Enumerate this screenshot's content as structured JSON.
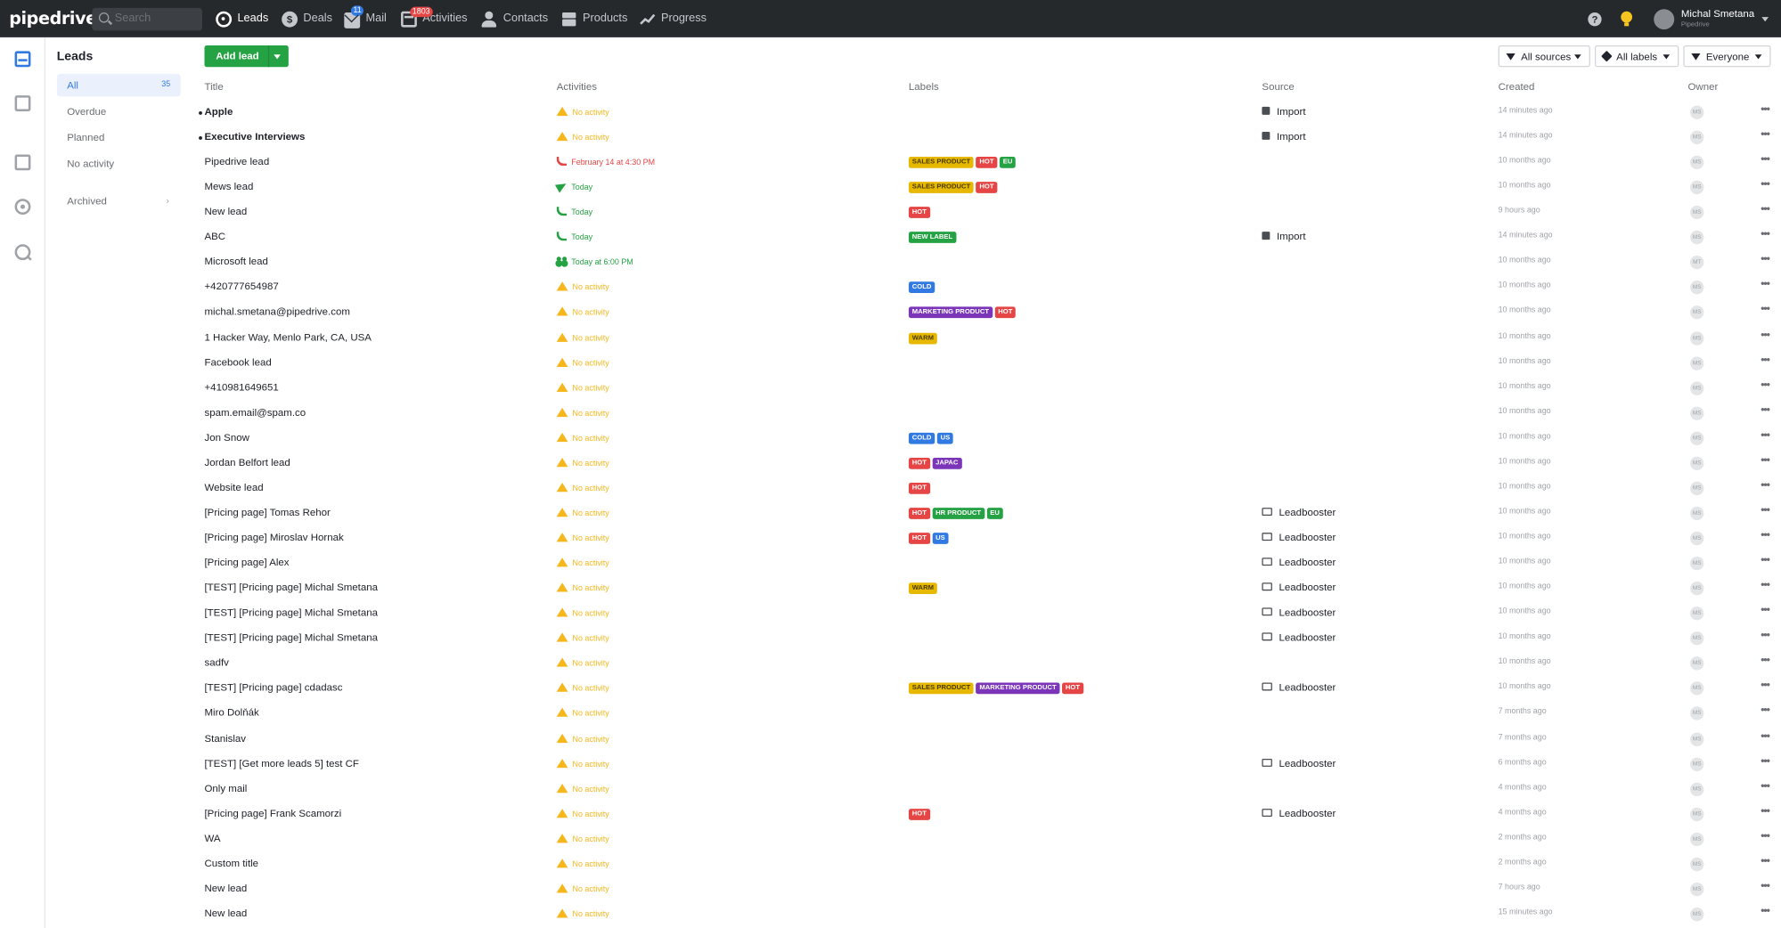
{
  "topbar": {
    "logo": "pipedrive",
    "search_placeholder": "Search",
    "nav": [
      {
        "label": "Leads",
        "icon": "target-icon",
        "active": true
      },
      {
        "label": "Deals",
        "icon": "dollar-icon"
      },
      {
        "label": "Mail",
        "icon": "mail-icon",
        "badge": "11"
      },
      {
        "label": "Activities",
        "icon": "calendar-icon",
        "badge": "1803"
      },
      {
        "label": "Contacts",
        "icon": "person-icon"
      },
      {
        "label": "Products",
        "icon": "box-icon"
      },
      {
        "label": "Progress",
        "icon": "trend-icon"
      }
    ],
    "help_icon": "?",
    "deals_icon": "$",
    "user_name": "Michal Smetana",
    "user_company": "Pipedrive"
  },
  "sidebar": {
    "title": "Leads",
    "items": [
      {
        "label": "All",
        "count": "35",
        "active": true
      },
      {
        "label": "Overdue"
      },
      {
        "label": "Planned"
      },
      {
        "label": "No activity"
      },
      {
        "label": "Archived",
        "chevron": "›"
      }
    ]
  },
  "toolbar": {
    "add_lead": "Add lead",
    "filters": [
      "All sources",
      "All labels",
      "Everyone"
    ]
  },
  "columns": [
    "Title",
    "Activities",
    "Labels",
    "Source",
    "Created",
    "Owner"
  ],
  "colors": {
    "accent": "#317ae2",
    "add_button": "#25a244",
    "warn": "#f5b71c",
    "overdue": "#e64545",
    "today": "#25a244"
  },
  "rows": [
    {
      "title": "Apple",
      "bold": true,
      "act": "No activity",
      "act_type": "none",
      "labels": [],
      "source": "Import",
      "src_type": "import",
      "created": "14 minutes ago",
      "owner": "MS"
    },
    {
      "title": "Executive Interviews",
      "bold": true,
      "act": "No activity",
      "act_type": "none",
      "labels": [],
      "source": "Import",
      "src_type": "import",
      "created": "14 minutes ago",
      "owner": "MS"
    },
    {
      "title": "Pipedrive lead",
      "act": "February 14 at 4:30 PM",
      "act_type": "overdue",
      "labels": [
        {
          "t": "SALES PRODUCT",
          "c": "#e6b800",
          "dark": true
        },
        {
          "t": "HOT",
          "c": "#e64545"
        },
        {
          "t": "EU",
          "c": "#25a244"
        }
      ],
      "source": "",
      "created": "10 months ago",
      "owner": "MS"
    },
    {
      "title": "Mews lead",
      "act": "Today",
      "act_type": "today-send",
      "labels": [
        {
          "t": "SALES PRODUCT",
          "c": "#e6b800",
          "dark": true
        },
        {
          "t": "HOT",
          "c": "#e64545"
        }
      ],
      "source": "",
      "created": "10 months ago",
      "owner": "MS"
    },
    {
      "title": "New lead",
      "act": "Today",
      "act_type": "today-call",
      "labels": [
        {
          "t": "HOT",
          "c": "#e64545"
        }
      ],
      "source": "",
      "created": "9 hours ago",
      "owner": "MS"
    },
    {
      "title": "ABC",
      "act": "Today",
      "act_type": "today-call",
      "labels": [
        {
          "t": "NEW LABEL",
          "c": "#25a244"
        }
      ],
      "source": "Import",
      "src_type": "import",
      "created": "14 minutes ago",
      "owner": "MS"
    },
    {
      "title": "Microsoft lead",
      "act": "Today at 6:00 PM",
      "act_type": "today-meet",
      "labels": [],
      "source": "",
      "created": "10 months ago",
      "owner": "MT"
    },
    {
      "title": "+420777654987",
      "act": "No activity",
      "act_type": "none",
      "labels": [
        {
          "t": "COLD",
          "c": "#317ae2"
        }
      ],
      "source": "",
      "created": "10 months ago",
      "owner": "MS"
    },
    {
      "title": "michal.smetana@pipedrive.com",
      "act": "No activity",
      "act_type": "none",
      "labels": [
        {
          "t": "MARKETING PRODUCT",
          "c": "#7a35b8"
        },
        {
          "t": "HOT",
          "c": "#e64545"
        }
      ],
      "source": "",
      "created": "10 months ago",
      "owner": "MS"
    },
    {
      "title": "1 Hacker Way, Menlo Park, CA, USA",
      "act": "No activity",
      "act_type": "none",
      "labels": [
        {
          "t": "WARM",
          "c": "#e6b800",
          "dark": true
        }
      ],
      "source": "",
      "created": "10 months ago",
      "owner": "MS"
    },
    {
      "title": "Facebook lead",
      "act": "No activity",
      "act_type": "none",
      "labels": [],
      "source": "",
      "created": "10 months ago",
      "owner": "MS"
    },
    {
      "title": "+410981649651",
      "act": "No activity",
      "act_type": "none",
      "labels": [],
      "source": "",
      "created": "10 months ago",
      "owner": "MS"
    },
    {
      "title": "spam.email@spam.co",
      "act": "No activity",
      "act_type": "none",
      "labels": [],
      "source": "",
      "created": "10 months ago",
      "owner": "MS"
    },
    {
      "title": "Jon Snow",
      "act": "No activity",
      "act_type": "none",
      "labels": [
        {
          "t": "COLD",
          "c": "#317ae2"
        },
        {
          "t": "US",
          "c": "#317ae2"
        }
      ],
      "source": "",
      "created": "10 months ago",
      "owner": "MS"
    },
    {
      "title": "Jordan Belfort lead",
      "act": "No activity",
      "act_type": "none",
      "labels": [
        {
          "t": "HOT",
          "c": "#e64545"
        },
        {
          "t": "JAPAC",
          "c": "#7a35b8"
        }
      ],
      "source": "",
      "created": "10 months ago",
      "owner": "MS"
    },
    {
      "title": "Website lead",
      "act": "No activity",
      "act_type": "none",
      "labels": [
        {
          "t": "HOT",
          "c": "#e64545"
        }
      ],
      "source": "",
      "created": "10 months ago",
      "owner": "MS"
    },
    {
      "title": "[Pricing page] Tomas Rehor",
      "act": "No activity",
      "act_type": "none",
      "labels": [
        {
          "t": "HOT",
          "c": "#e64545"
        },
        {
          "t": "HR PRODUCT",
          "c": "#25a244"
        },
        {
          "t": "EU",
          "c": "#25a244"
        }
      ],
      "source": "Leadbooster",
      "src_type": "lb",
      "created": "10 months ago",
      "owner": "MS"
    },
    {
      "title": "[Pricing page] Miroslav Hornak",
      "act": "No activity",
      "act_type": "none",
      "labels": [
        {
          "t": "HOT",
          "c": "#e64545"
        },
        {
          "t": "US",
          "c": "#317ae2"
        }
      ],
      "source": "Leadbooster",
      "src_type": "lb",
      "created": "10 months ago",
      "owner": "MS"
    },
    {
      "title": "[Pricing page] Alex",
      "act": "No activity",
      "act_type": "none",
      "labels": [],
      "source": "Leadbooster",
      "src_type": "lb",
      "created": "10 months ago",
      "owner": "MS"
    },
    {
      "title": "[TEST] [Pricing page] Michal Smetana",
      "act": "No activity",
      "act_type": "none",
      "labels": [
        {
          "t": "WARM",
          "c": "#e6b800",
          "dark": true
        }
      ],
      "source": "Leadbooster",
      "src_type": "lb",
      "created": "10 months ago",
      "owner": "MS"
    },
    {
      "title": "[TEST] [Pricing page] Michal Smetana",
      "act": "No activity",
      "act_type": "none",
      "labels": [],
      "source": "Leadbooster",
      "src_type": "lb",
      "created": "10 months ago",
      "owner": "MS"
    },
    {
      "title": "[TEST] [Pricing page] Michal Smetana",
      "act": "No activity",
      "act_type": "none",
      "labels": [],
      "source": "Leadbooster",
      "src_type": "lb",
      "created": "10 months ago",
      "owner": "MS"
    },
    {
      "title": "sadfv",
      "act": "No activity",
      "act_type": "none",
      "labels": [],
      "source": "",
      "created": "10 months ago",
      "owner": "MS"
    },
    {
      "title": "[TEST] [Pricing page] cdadasc",
      "act": "No activity",
      "act_type": "none",
      "labels": [
        {
          "t": "SALES PRODUCT",
          "c": "#e6b800",
          "dark": true
        },
        {
          "t": "MARKETING PRODUCT",
          "c": "#7a35b8"
        },
        {
          "t": "HOT",
          "c": "#e64545"
        }
      ],
      "source": "Leadbooster",
      "src_type": "lb",
      "created": "10 months ago",
      "owner": "MS"
    },
    {
      "title": "Miro Dolňák",
      "act": "No activity",
      "act_type": "none",
      "labels": [],
      "source": "",
      "created": "7 months ago",
      "owner": "MS"
    },
    {
      "title": "Stanislav",
      "act": "No activity",
      "act_type": "none",
      "labels": [],
      "source": "",
      "created": "7 months ago",
      "owner": "MS"
    },
    {
      "title": "[TEST] [Get more leads 5] test CF",
      "act": "No activity",
      "act_type": "none",
      "labels": [],
      "source": "Leadbooster",
      "src_type": "lb",
      "created": "6 months ago",
      "owner": "MS"
    },
    {
      "title": "Only mail",
      "act": "No activity",
      "act_type": "none",
      "labels": [],
      "source": "",
      "created": "4 months ago",
      "owner": "MS"
    },
    {
      "title": "[Pricing page] Frank Scamorzi",
      "act": "No activity",
      "act_type": "none",
      "labels": [
        {
          "t": "HOT",
          "c": "#e64545"
        }
      ],
      "source": "Leadbooster",
      "src_type": "lb",
      "created": "4 months ago",
      "owner": "MS"
    },
    {
      "title": "WA",
      "act": "No activity",
      "act_type": "none",
      "labels": [],
      "source": "",
      "created": "2 months ago",
      "owner": "MS"
    },
    {
      "title": "Custom title",
      "act": "No activity",
      "act_type": "none",
      "labels": [],
      "source": "",
      "created": "2 months ago",
      "owner": "MS"
    },
    {
      "title": "New lead",
      "act": "No activity",
      "act_type": "none",
      "labels": [],
      "source": "",
      "created": "7 hours ago",
      "owner": "MS"
    },
    {
      "title": "New lead",
      "act": "No activity",
      "act_type": "none",
      "labels": [],
      "source": "",
      "created": "15 minutes ago",
      "owner": "MS"
    }
  ]
}
